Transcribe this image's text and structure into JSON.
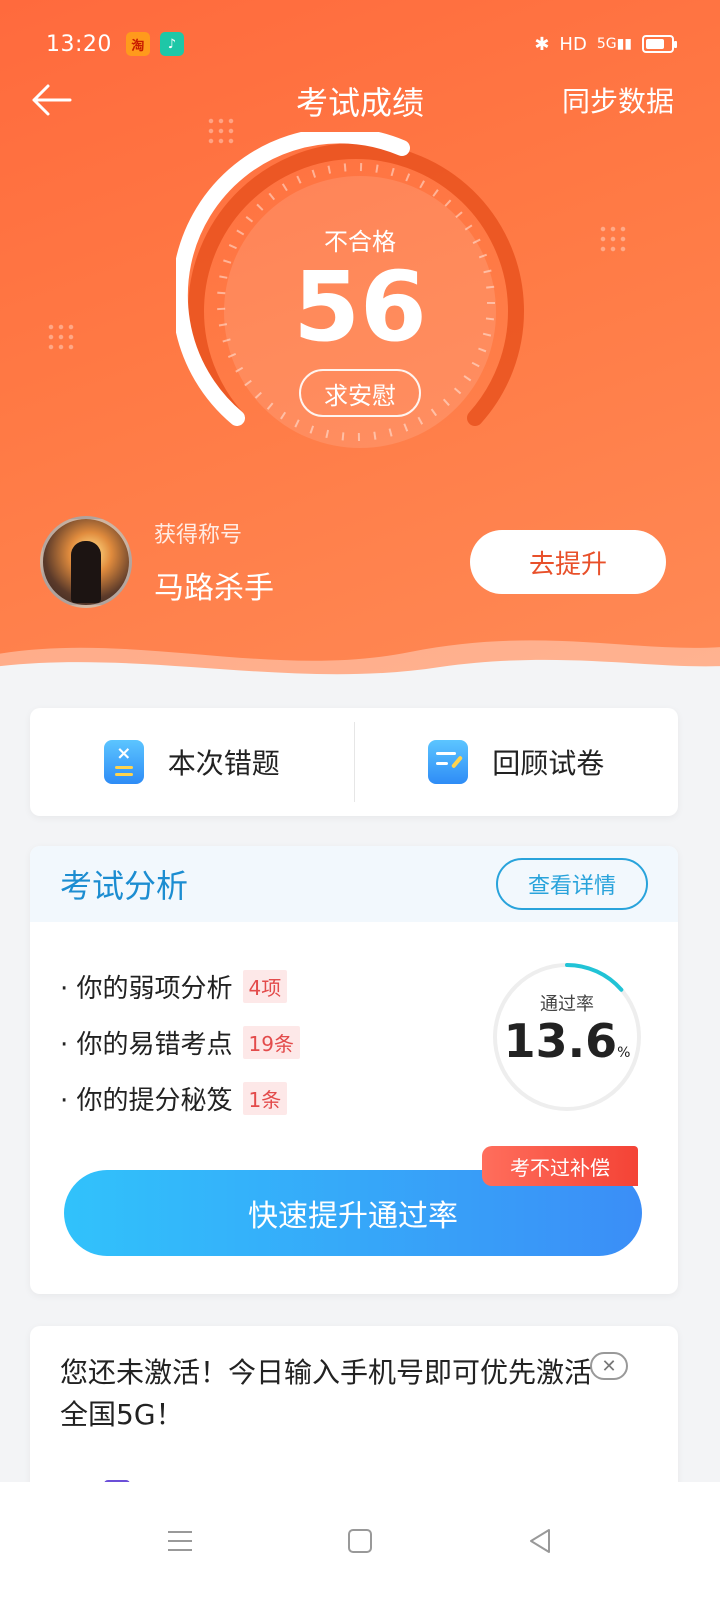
{
  "status_bar": {
    "time": "13:20",
    "app1_icon": "taobao-icon",
    "app2_icon": "music-icon",
    "network": "HD",
    "signal": "5G"
  },
  "nav": {
    "title": "考试成绩",
    "sync_label": "同步数据"
  },
  "score": {
    "status": "不合格",
    "value": "56",
    "comfort_label": "求安慰"
  },
  "user": {
    "title_label": "获得称号",
    "title": "马路杀手",
    "improve_label": "去提升"
  },
  "quick_actions": [
    {
      "label": "本次错题",
      "icon": "wrong-questions-icon"
    },
    {
      "label": "回顾试卷",
      "icon": "review-paper-icon"
    }
  ],
  "analysis": {
    "title": "考试分析",
    "detail_label": "查看详情",
    "items": [
      {
        "label": "· 你的弱项分析",
        "tag": "4项"
      },
      {
        "label": "· 你的易错考点",
        "tag": "19条"
      },
      {
        "label": "· 你的提分秘笈",
        "tag": "1条"
      }
    ],
    "pass_rate_label": "通过率",
    "pass_rate_value": "13.6",
    "pass_rate_unit": "%",
    "boost_label": "快速提升通过率",
    "compensation_badge": "考不过补偿"
  },
  "promo": {
    "text": "您还未激活！今日输入手机号即可优先激活全国5G！"
  },
  "colors": {
    "accent": "#ff6a3d",
    "blue": "#29a3db",
    "tag_red": "#e34b4b"
  }
}
